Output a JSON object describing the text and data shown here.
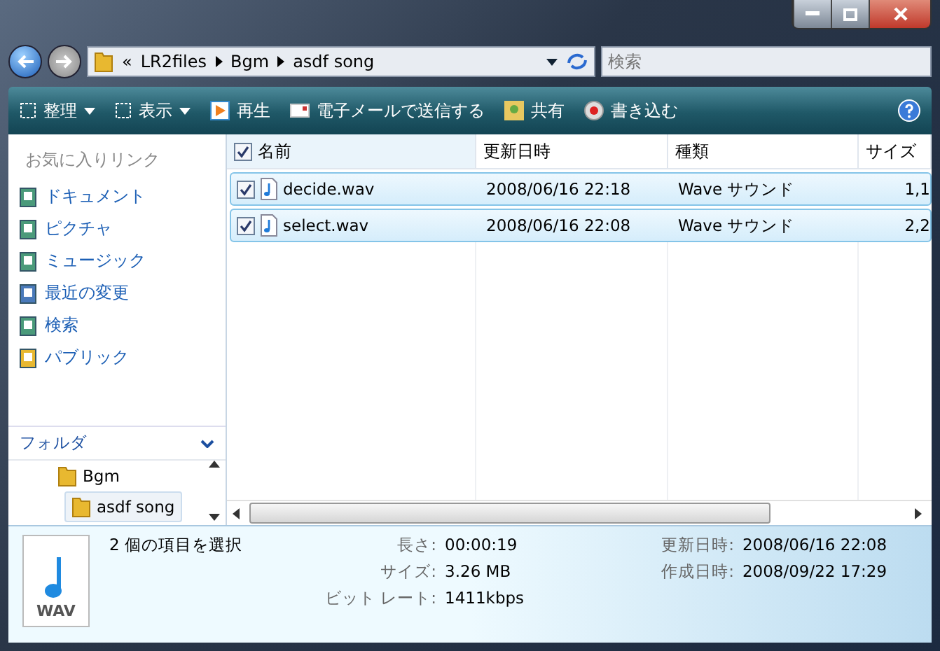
{
  "address": {
    "overflow": "«",
    "crumbs": [
      "LR2files",
      "Bgm",
      "asdf song"
    ]
  },
  "search": {
    "placeholder": "検索"
  },
  "toolbar": [
    {
      "label": "整理",
      "kind": "menu"
    },
    {
      "label": "表示",
      "kind": "menu"
    },
    {
      "label": "再生",
      "kind": "play"
    },
    {
      "label": "電子メールで送信する",
      "kind": "mail"
    },
    {
      "label": "共有",
      "kind": "share"
    },
    {
      "label": "書き込む",
      "kind": "burn"
    }
  ],
  "favorites": {
    "title": "お気に入りリンク",
    "items": [
      {
        "label": "ドキュメント",
        "kind": "doc"
      },
      {
        "label": "ピクチャ",
        "kind": "pic"
      },
      {
        "label": "ミュージック",
        "kind": "music"
      },
      {
        "label": "最近の変更",
        "kind": "recent"
      },
      {
        "label": "検索",
        "kind": "search"
      },
      {
        "label": "パブリック",
        "kind": "folder"
      }
    ]
  },
  "folders": {
    "title": "フォルダ",
    "children": [
      {
        "label": "Bgm",
        "selected": false,
        "children": [
          {
            "label": "asdf song",
            "selected": true
          }
        ]
      }
    ]
  },
  "table": {
    "all_checked": true,
    "columns": [
      "名前",
      "更新日時",
      "種類",
      "サイズ"
    ],
    "rows": [
      {
        "name": "decide.wav",
        "modified": "2008/06/16 22:18",
        "type": "Wave サウンド",
        "size": "1,1",
        "checked": true,
        "selected": true
      },
      {
        "name": "select.wav",
        "modified": "2008/06/16 22:08",
        "type": "Wave サウンド",
        "size": "2,2",
        "checked": true,
        "selected": true
      }
    ]
  },
  "details": {
    "file_icon_label": "WAV",
    "summary": "2 個の項目を選択",
    "props": [
      {
        "label": "長さ:",
        "value": "00:00:19"
      },
      {
        "label": "サイズ:",
        "value": "3.26 MB"
      },
      {
        "label": "ビット レート:",
        "value": "1411kbps"
      }
    ],
    "dates": [
      {
        "label": "更新日時:",
        "value": "2008/06/16 22:08"
      },
      {
        "label": "作成日時:",
        "value": "2008/09/22 17:29"
      }
    ]
  }
}
